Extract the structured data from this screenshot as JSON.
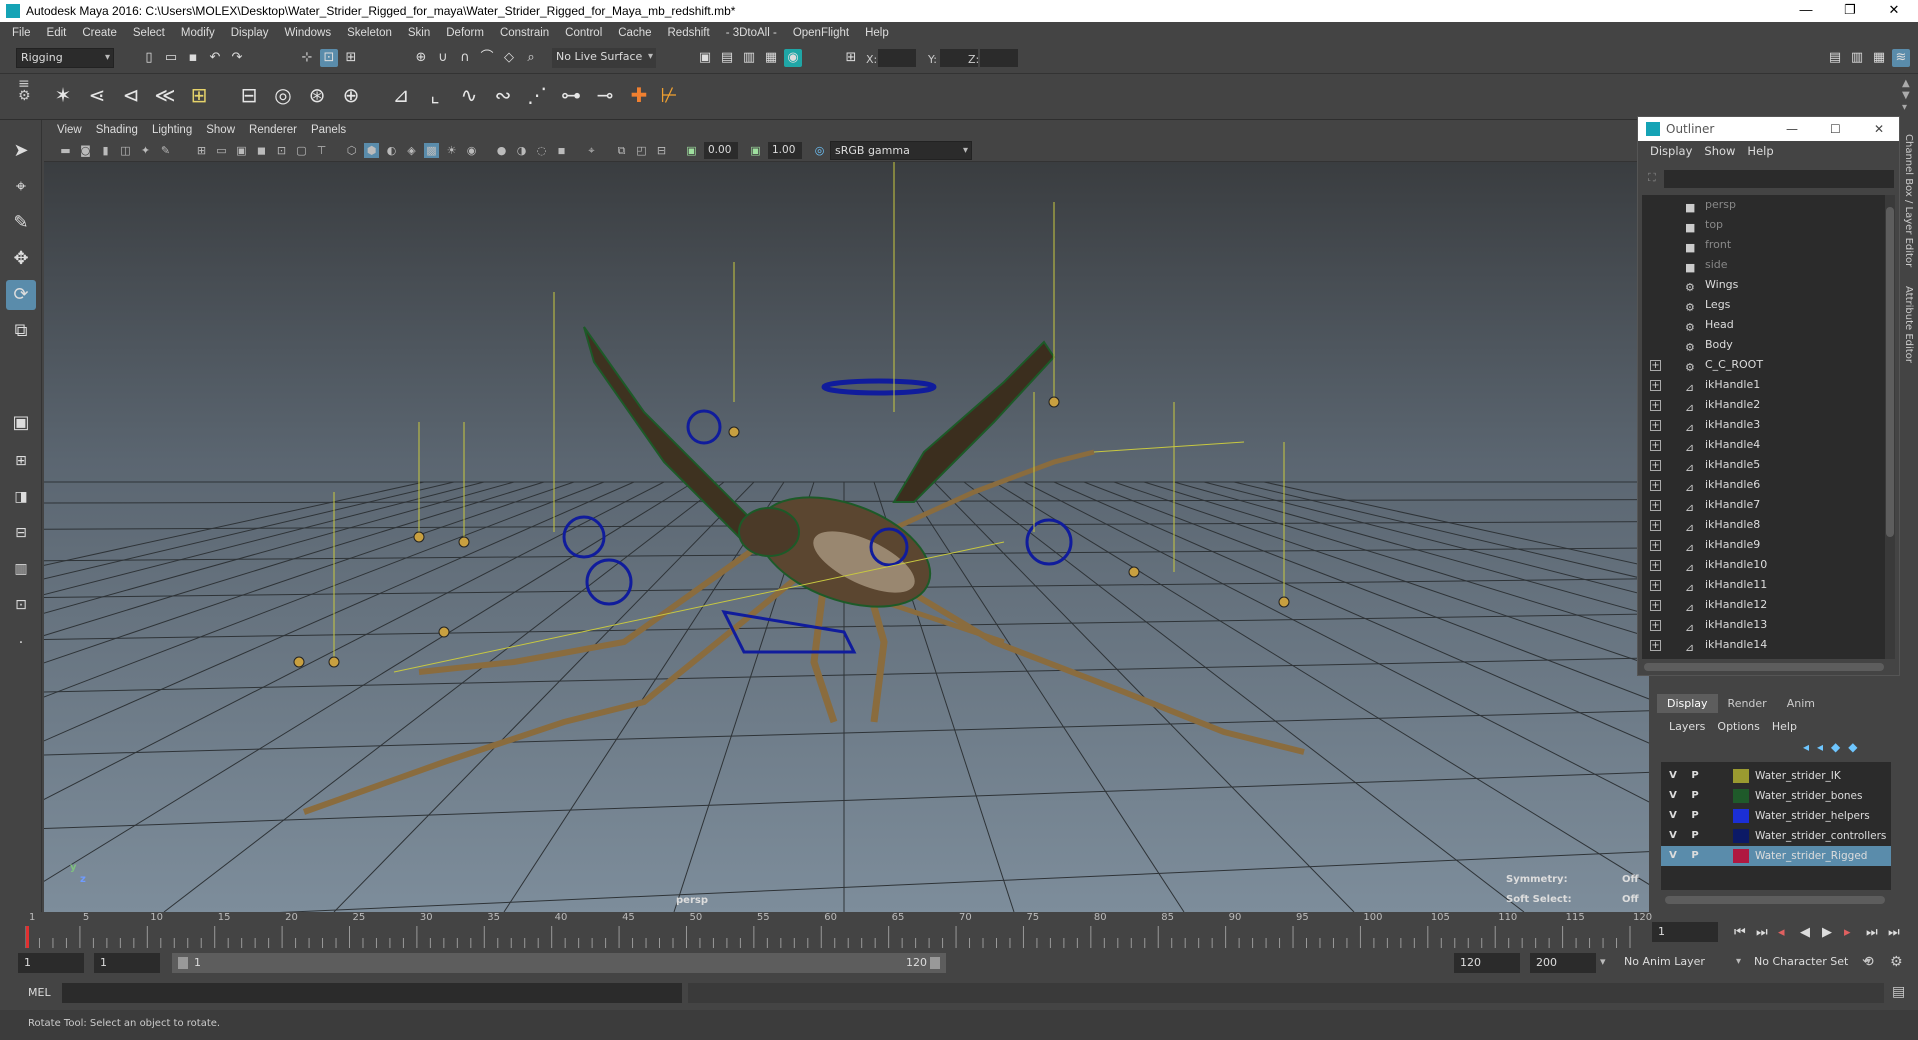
{
  "window": {
    "title": "Autodesk Maya 2016: C:\\Users\\MOLEX\\Desktop\\Water_Strider_Rigged_for_maya\\Water_Strider_Rigged_for_Maya_mb_redshift.mb*",
    "minimize_glyph": "—",
    "maximize_glyph": "❐",
    "close_glyph": "✕"
  },
  "menubar": [
    "File",
    "Edit",
    "Create",
    "Select",
    "Modify",
    "Display",
    "Windows",
    "Skeleton",
    "Skin",
    "Deform",
    "Constrain",
    "Control",
    "Cache",
    "Redshift",
    "- 3DtoAll -",
    "OpenFlight",
    "Help"
  ],
  "statusline": {
    "menu_set": "Rigging",
    "live_surface": "No Live Surface",
    "x_label": "X:",
    "y_label": "Y:",
    "z_label": "Z:"
  },
  "panel": {
    "menus": [
      "View",
      "Shading",
      "Lighting",
      "Show",
      "Renderer",
      "Panels"
    ],
    "exposure": "0.00",
    "gamma": "1.00",
    "color_space": "sRGB gamma"
  },
  "viewport": {
    "camera_label": "persp",
    "symmetry_label": "Symmetry:",
    "symmetry_value": "Off",
    "soft_select_label": "Soft Select:",
    "soft_select_value": "Off",
    "axis_y": "y",
    "axis_z": "z"
  },
  "outliner": {
    "title": "Outliner",
    "menus": [
      "Display",
      "Show",
      "Help"
    ],
    "items": [
      {
        "label": "persp",
        "icon": "camera-icon",
        "dim": true,
        "expandable": false
      },
      {
        "label": "top",
        "icon": "camera-icon",
        "dim": true,
        "expandable": false
      },
      {
        "label": "front",
        "icon": "camera-icon",
        "dim": true,
        "expandable": false
      },
      {
        "label": "side",
        "icon": "camera-icon",
        "dim": true,
        "expandable": false
      },
      {
        "label": "Wings",
        "icon": "group-icon",
        "dim": false,
        "expandable": false
      },
      {
        "label": "Legs",
        "icon": "group-icon",
        "dim": false,
        "expandable": false
      },
      {
        "label": "Head",
        "icon": "group-icon",
        "dim": false,
        "expandable": false
      },
      {
        "label": "Body",
        "icon": "group-icon",
        "dim": false,
        "expandable": false
      },
      {
        "label": "C_C_ROOT",
        "icon": "group-icon",
        "dim": false,
        "expandable": true
      },
      {
        "label": "ikHandle1",
        "icon": "ik-handle-icon",
        "dim": false,
        "expandable": true
      },
      {
        "label": "ikHandle2",
        "icon": "ik-handle-icon",
        "dim": false,
        "expandable": true
      },
      {
        "label": "ikHandle3",
        "icon": "ik-handle-icon",
        "dim": false,
        "expandable": true
      },
      {
        "label": "ikHandle4",
        "icon": "ik-handle-icon",
        "dim": false,
        "expandable": true
      },
      {
        "label": "ikHandle5",
        "icon": "ik-handle-icon",
        "dim": false,
        "expandable": true
      },
      {
        "label": "ikHandle6",
        "icon": "ik-handle-icon",
        "dim": false,
        "expandable": true
      },
      {
        "label": "ikHandle7",
        "icon": "ik-handle-icon",
        "dim": false,
        "expandable": true
      },
      {
        "label": "ikHandle8",
        "icon": "ik-handle-icon",
        "dim": false,
        "expandable": true
      },
      {
        "label": "ikHandle9",
        "icon": "ik-handle-icon",
        "dim": false,
        "expandable": true
      },
      {
        "label": "ikHandle10",
        "icon": "ik-handle-icon",
        "dim": false,
        "expandable": true
      },
      {
        "label": "ikHandle11",
        "icon": "ik-handle-icon",
        "dim": false,
        "expandable": true
      },
      {
        "label": "ikHandle12",
        "icon": "ik-handle-icon",
        "dim": false,
        "expandable": true
      },
      {
        "label": "ikHandle13",
        "icon": "ik-handle-icon",
        "dim": false,
        "expandable": true
      },
      {
        "label": "ikHandle14",
        "icon": "ik-handle-icon",
        "dim": false,
        "expandable": true
      }
    ]
  },
  "side_tabs": [
    "Channel Box / Layer Editor",
    "Attribute Editor"
  ],
  "layer_editor": {
    "tabs": [
      "Display",
      "Render",
      "Anim"
    ],
    "active_tab": "Display",
    "menus": [
      "Layers",
      "Options",
      "Help"
    ],
    "layers": [
      {
        "v": "V",
        "p": "P",
        "name": "Water_strider_IK",
        "color": "#9a9a30",
        "selected": false
      },
      {
        "v": "V",
        "p": "P",
        "name": "Water_strider_bones",
        "color": "#1f5a2a",
        "selected": false
      },
      {
        "v": "V",
        "p": "P",
        "name": "Water_strider_helpers",
        "color": "#1b2fd6",
        "selected": false
      },
      {
        "v": "V",
        "p": "P",
        "name": "Water_strider_controllers",
        "color": "#0c1a66",
        "selected": false
      },
      {
        "v": "V",
        "p": "P",
        "name": "Water_strider_Rigged",
        "color": "#b01840",
        "selected": true
      }
    ]
  },
  "timeline": {
    "tick_labels": [
      "1",
      "5",
      "10",
      "15",
      "20",
      "25",
      "30",
      "35",
      "40",
      "45",
      "50",
      "55",
      "60",
      "65",
      "70",
      "75",
      "80",
      "85",
      "90",
      "95",
      "100",
      "105",
      "110",
      "115",
      "120"
    ],
    "current_frame": "1"
  },
  "range": {
    "start": "1",
    "playback_start": "1",
    "slider_start": "1",
    "slider_end": "120",
    "playback_end": "120",
    "end": "200",
    "anim_layer": "No Anim Layer",
    "character_set": "No Character Set"
  },
  "command_line": {
    "language": "MEL"
  },
  "help_line": "Rotate Tool: Select an object to rotate."
}
